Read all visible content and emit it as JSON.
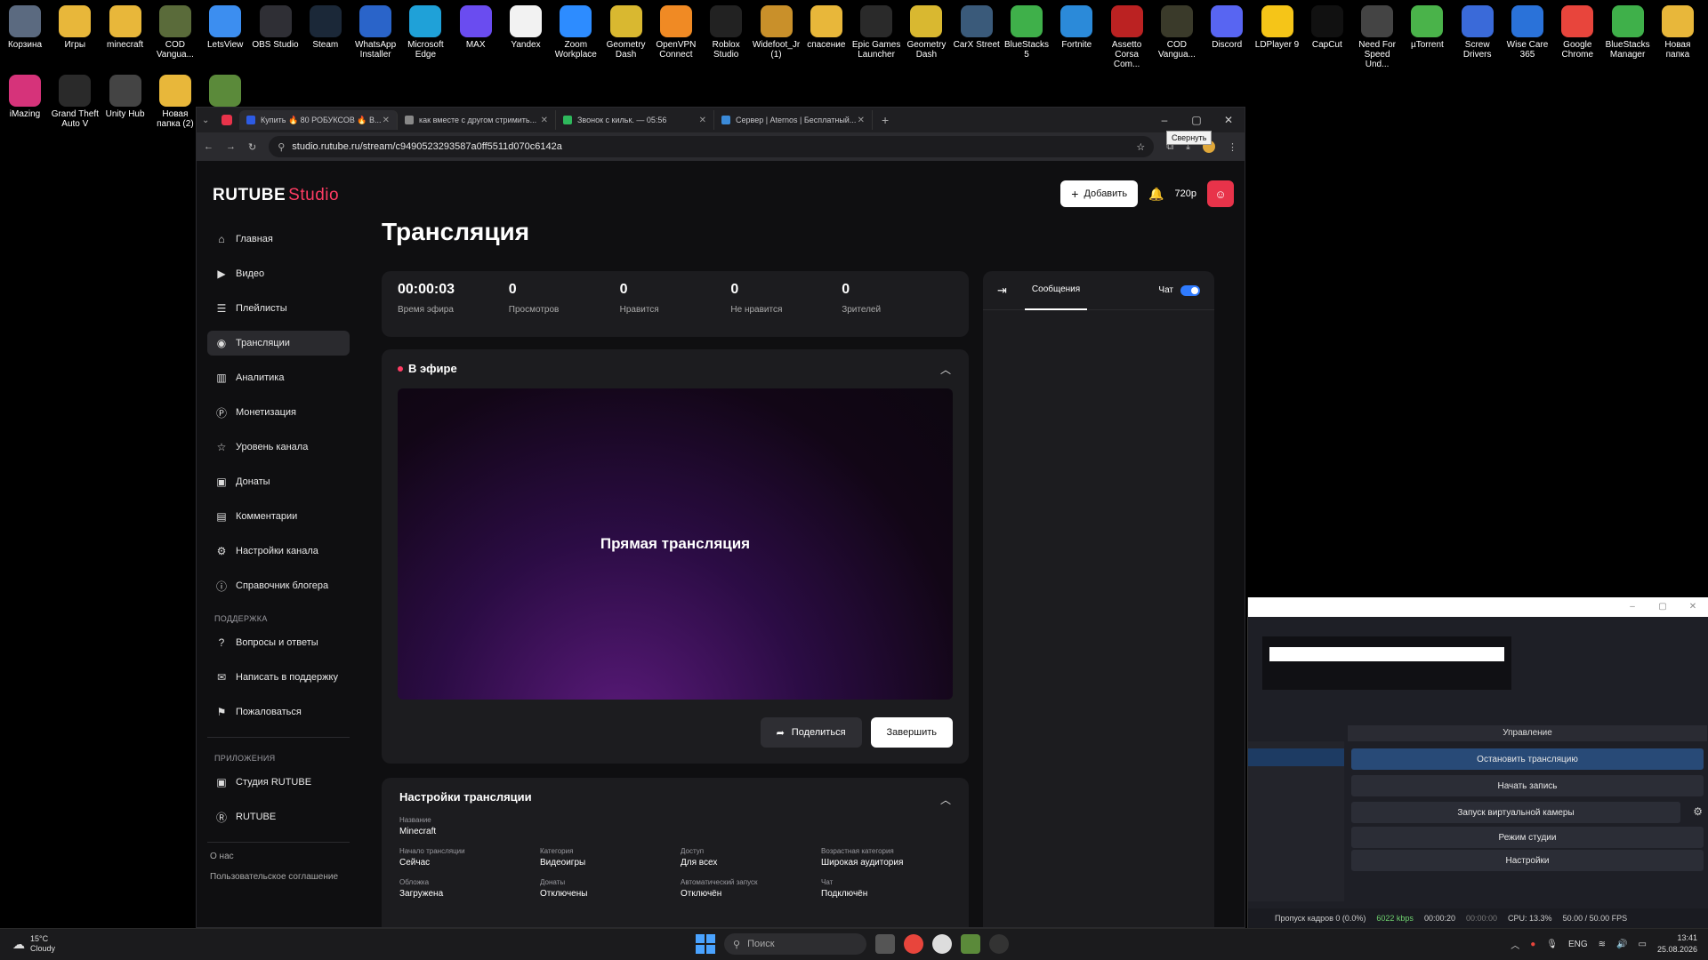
{
  "desktop": {
    "icons_row1": [
      {
        "label": "Корзина",
        "icon": "trash-icon",
        "color": "#5b6a80"
      },
      {
        "label": "Игры",
        "icon": "folder-icon",
        "color": "#e8b73a"
      },
      {
        "label": "minecraft",
        "icon": "folder-icon",
        "color": "#e8b73a"
      },
      {
        "label": "COD Vangua...",
        "icon": "cod-icon",
        "color": "#5a6b3a"
      },
      {
        "label": "LetsView",
        "icon": "letsview-icon",
        "color": "#3c8ef0"
      },
      {
        "label": "OBS Studio",
        "icon": "obs-icon",
        "color": "#2f2f35"
      },
      {
        "label": "Steam",
        "icon": "steam-icon",
        "color": "#1b2838"
      },
      {
        "label": "WhatsApp Installer",
        "icon": "download-icon",
        "color": "#2a64c9"
      },
      {
        "label": "Microsoft Edge",
        "icon": "edge-icon",
        "color": "#1fa1d8"
      },
      {
        "label": "MAX",
        "icon": "max-icon",
        "color": "#6a4cf0"
      },
      {
        "label": "Yandex",
        "icon": "yandex-icon",
        "color": "#f2f2f2"
      },
      {
        "label": "Zoom Workplace",
        "icon": "zoom-icon",
        "color": "#2d8cff"
      },
      {
        "label": "Geometry Dash",
        "icon": "gd-icon",
        "color": "#d9b830"
      },
      {
        "label": "OpenVPN Connect",
        "icon": "openvpn-icon",
        "color": "#f08a24"
      },
      {
        "label": "Roblox Studio",
        "icon": "roblox-icon",
        "color": "#222"
      },
      {
        "label": "Widefoot_Jr (1)",
        "icon": "widefoot-icon",
        "color": "#c9902a"
      },
      {
        "label": "спасение",
        "icon": "folder-icon",
        "color": "#e8b73a"
      },
      {
        "label": "Epic Games Launcher",
        "icon": "epic-icon",
        "color": "#2a2a2a"
      },
      {
        "label": "Geometry Dash",
        "icon": "gd-icon",
        "color": "#d9b830"
      },
      {
        "label": "CarX Street",
        "icon": "carx-icon",
        "color": "#3a5a7a"
      },
      {
        "label": "BlueStacks 5",
        "icon": "bluestacks-icon",
        "color": "#3fb04a"
      },
      {
        "label": "Fortnite",
        "icon": "fortnite-icon",
        "color": "#2b8ad9"
      },
      {
        "label": "Assetto Corsa Com...",
        "icon": "assetto-icon",
        "color": "#b22"
      },
      {
        "label": "COD Vangua...",
        "icon": "cod-icon",
        "color": "#3a3a2a"
      },
      {
        "label": "Discord",
        "icon": "discord-icon",
        "color": "#5865f2"
      },
      {
        "label": "LDPlayer 9",
        "icon": "ldplayer-icon",
        "color": "#f5c518"
      },
      {
        "label": "CapCut",
        "icon": "capcut-icon",
        "color": "#111"
      },
      {
        "label": "Need For Speed Und...",
        "icon": "nfs-icon",
        "color": "#444"
      },
      {
        "label": "µTorrent",
        "icon": "utorrent-icon",
        "color": "#4ab34a"
      },
      {
        "label": "Screw Drivers",
        "icon": "sd-icon",
        "color": "#3a6ad9"
      },
      {
        "label": "Wise Care 365",
        "icon": "wisecare-icon",
        "color": "#2a72d9"
      },
      {
        "label": "Google Chrome",
        "icon": "chrome-icon",
        "color": "#e8453c"
      },
      {
        "label": "BlueStacks Manager",
        "icon": "bluestacks-icon",
        "color": "#3fb04a"
      },
      {
        "label": "Новая папка",
        "icon": "folder-icon",
        "color": "#e8b73a"
      }
    ],
    "icons_row2": [
      {
        "label": "iMazing",
        "icon": "imazing-icon",
        "color": "#d6337a"
      },
      {
        "label": "Grand Theft Auto V",
        "icon": "gta-icon",
        "color": "#2a2a2a"
      },
      {
        "label": "Unity Hub",
        "icon": "unity-icon",
        "color": "#444"
      },
      {
        "label": "Новая папка (2)",
        "icon": "folder-icon",
        "color": "#e8b73a"
      },
      {
        "label": "",
        "icon": "minecraft-icon",
        "color": "#5b8a3a"
      }
    ]
  },
  "browser": {
    "tabs": [
      {
        "label": "Купить 🔥 80 РОБУКСОВ 🔥 В...",
        "favicon_color": "#2d5be3"
      },
      {
        "label": "как вместе с другом стримить...",
        "favicon_color": "#888"
      },
      {
        "label": "Звонок с кильк. — 05:56",
        "favicon_color": "#2eb85c"
      },
      {
        "label": "Сервер | Aternos | Бесплатный...",
        "favicon_color": "#3b8bd9"
      }
    ],
    "url": "studio.rutube.ru/stream/c9490523293587a0ff5511d070c6142a",
    "tooltip": "Свернуть"
  },
  "app": {
    "logo_main": "RUTUBE",
    "logo_sub": "Studio",
    "add_button": "Добавить",
    "quality": "720p",
    "page_title": "Трансляция",
    "nav": [
      {
        "label": "Главная",
        "icon": "home-icon",
        "glyph": "⌂"
      },
      {
        "label": "Видео",
        "icon": "video-icon",
        "glyph": "▶"
      },
      {
        "label": "Плейлисты",
        "icon": "playlist-icon",
        "glyph": "☰"
      },
      {
        "label": "Трансляции",
        "icon": "broadcast-icon",
        "glyph": "◉"
      },
      {
        "label": "Аналитика",
        "icon": "analytics-icon",
        "glyph": "▥"
      },
      {
        "label": "Монетизация",
        "icon": "monetization-icon",
        "glyph": "Ⓟ"
      },
      {
        "label": "Уровень канала",
        "icon": "star-icon",
        "glyph": "☆"
      },
      {
        "label": "Донаты",
        "icon": "donate-icon",
        "glyph": "▣"
      },
      {
        "label": "Комментарии",
        "icon": "comments-icon",
        "glyph": "▤"
      },
      {
        "label": "Настройки канала",
        "icon": "gear-icon",
        "glyph": "⚙"
      },
      {
        "label": "Справочник блогера",
        "icon": "info-icon",
        "glyph": "ⓘ"
      }
    ],
    "support_title": "ПОДДЕРЖКА",
    "support": [
      {
        "label": "Вопросы и ответы",
        "icon": "question-icon",
        "glyph": "?"
      },
      {
        "label": "Написать в поддержку",
        "icon": "mail-icon",
        "glyph": "✉"
      },
      {
        "label": "Пожаловаться",
        "icon": "flag-icon",
        "glyph": "⚑"
      }
    ],
    "apps_title": "ПРИЛОЖЕНИЯ",
    "apps": [
      {
        "label": "Студия RUTUBE",
        "icon": "studio-app-icon",
        "glyph": "▣"
      },
      {
        "label": "RUTUBE",
        "icon": "rutube-app-icon",
        "glyph": "Ⓡ"
      }
    ],
    "footer_links": [
      "О нас",
      "Пользовательское соглашение"
    ],
    "stats": [
      {
        "value": "00:00:03",
        "label": "Время эфира"
      },
      {
        "value": "0",
        "label": "Просмотров"
      },
      {
        "value": "0",
        "label": "Нравится"
      },
      {
        "value": "0",
        "label": "Не нравится"
      },
      {
        "value": "0",
        "label": "Зрителей"
      }
    ],
    "live_title": "В эфире",
    "player_text": "Прямая трансляция",
    "share_button": "Поделиться",
    "end_button": "Завершить",
    "settings_title": "Настройки трансляции",
    "settings_name_label": "Название",
    "settings_name_value": "Minecraft",
    "settings_fields": [
      {
        "label": "Начало трансляции",
        "value": "Сейчас"
      },
      {
        "label": "Категория",
        "value": "Видеоигры"
      },
      {
        "label": "Доступ",
        "value": "Для всех"
      },
      {
        "label": "Возрастная категория",
        "value": "Широкая аудитория"
      },
      {
        "label": "Обложка",
        "value": "Загружена"
      },
      {
        "label": "Донаты",
        "value": "Отключены"
      },
      {
        "label": "Автоматический запуск",
        "value": "Отключён"
      },
      {
        "label": "Чат",
        "value": "Подключён"
      }
    ],
    "chat_tab": "Сообщения",
    "chat_toggle_label": "Чат"
  },
  "obs": {
    "controls_title": "Управление",
    "buttons": [
      "Остановить трансляцию",
      "Начать запись",
      "Запуск виртуальной камеры",
      "Режим студии",
      "Настройки"
    ],
    "status": {
      "dropped": "Пропуск кадров 0 (0.0%)",
      "bitrate": "6022 kbps",
      "stream_time": "00:00:20",
      "rec_time": "00:00:00",
      "cpu": "CPU: 13.3%",
      "fps": "50.00 / 50.00 FPS"
    }
  },
  "taskbar": {
    "weather_temp": "15°C",
    "weather_desc": "Cloudy",
    "search_placeholder": "Поиск",
    "lang": "ENG",
    "time": "13:41",
    "date": "25.08.2026"
  }
}
